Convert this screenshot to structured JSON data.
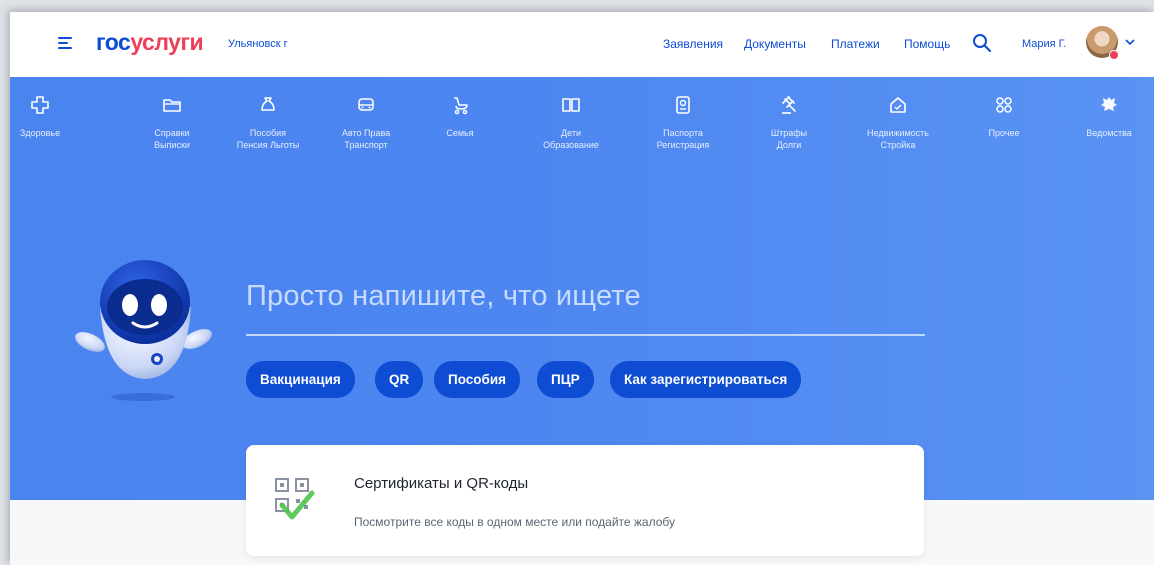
{
  "header": {
    "logo_part1": "гос",
    "logo_part2": "услуги",
    "city": "Ульяновск г",
    "nav": [
      "Заявления",
      "Документы",
      "Платежи",
      "Помощь"
    ],
    "user_name": "Мария Г."
  },
  "categories": [
    {
      "label": "Здоровье",
      "icon": "health-cross-icon"
    },
    {
      "label": "Справки\nВыписки",
      "icon": "folder-icon"
    },
    {
      "label": "Пособия\nПенсия Льготы",
      "icon": "money-bag-icon"
    },
    {
      "label": "Авто Права\nТранспорт",
      "icon": "car-icon"
    },
    {
      "label": "Семья",
      "icon": "stroller-icon"
    },
    {
      "label": "Дети\nОбразование",
      "icon": "book-icon"
    },
    {
      "label": "Паспорта\nРегистрация",
      "icon": "passport-icon"
    },
    {
      "label": "Штрафы\nДолги",
      "icon": "gavel-icon"
    },
    {
      "label": "Недвижимость\nСтройка",
      "icon": "house-icon"
    },
    {
      "label": "Прочее",
      "icon": "grid-icon"
    },
    {
      "label": "Ведомства",
      "icon": "coat-of-arms-icon"
    }
  ],
  "search": {
    "placeholder": "Просто напишите, что ищете"
  },
  "chips": [
    "Вакцинация",
    "QR",
    "Пособия",
    "ПЦР",
    "Как зарегистрироваться"
  ],
  "card": {
    "title": "Сертификаты и QR-коды",
    "subtitle": "Посмотрите все коды в одном месте или подайте жалобу"
  },
  "colors": {
    "brand_blue": "#0d4cd3",
    "brand_red": "#ee3f58",
    "hero_blue": "#4d86f0"
  }
}
